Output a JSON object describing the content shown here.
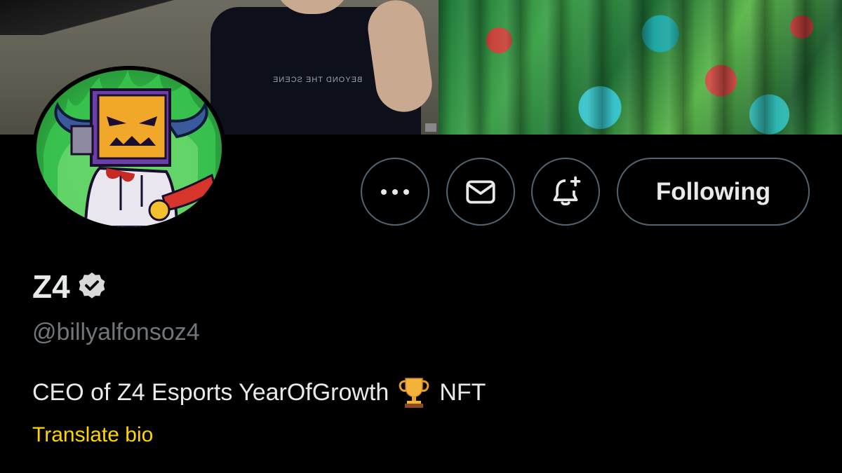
{
  "banner": {
    "shirt_print": "BEYOND THE SCENE"
  },
  "actions": {
    "more_icon": "more-dots-icon",
    "message_icon": "envelope-icon",
    "notify_icon": "bell-plus-icon",
    "following_label": "Following"
  },
  "profile": {
    "name": "Z4",
    "verified_icon": "verified-badge-icon",
    "handle": "@billyalfonsoz4",
    "bio_before": "CEO of Z4 Esports YearOfGrowth",
    "bio_emoji_icon": "trophy-icon",
    "bio_after": "NFT",
    "translate_label": "Translate bio"
  },
  "colors": {
    "background": "#000000",
    "text_primary": "#e7e9ea",
    "text_secondary": "#71767b",
    "button_border": "#536471",
    "translate_link": "#ffd400"
  }
}
